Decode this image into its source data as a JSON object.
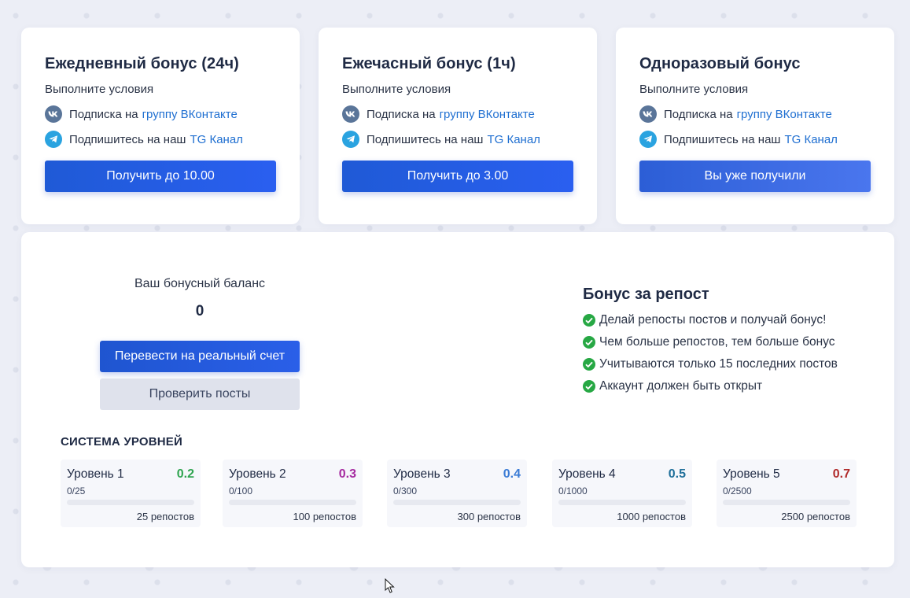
{
  "bonuses": [
    {
      "title": "Ежедневный бонус (24ч)",
      "subtitle": "Выполните условия",
      "vk_text": "Подписка на",
      "vk_link": "группу ВКонтакте",
      "tg_text": "Подпишитесь на наш",
      "tg_link": "TG Канал",
      "button": "Получить до 10.00"
    },
    {
      "title": "Ежечасный бонус (1ч)",
      "subtitle": "Выполните условия",
      "vk_text": "Подписка на",
      "vk_link": "группу ВКонтакте",
      "tg_text": "Подпишитесь на наш",
      "tg_link": "TG Канал",
      "button": "Получить до 3.00"
    },
    {
      "title": "Одноразовый бонус",
      "subtitle": "Выполните условия",
      "vk_text": "Подписка на",
      "vk_link": "группу ВКонтакте",
      "tg_text": "Подпишитесь на наш",
      "tg_link": "TG Канал",
      "button": "Вы уже получили"
    }
  ],
  "balance": {
    "label": "Ваш бонусный баланс",
    "value": "0",
    "transfer_button": "Перевести на реальный счет",
    "check_button": "Проверить посты"
  },
  "repost": {
    "title": "Бонус за репост",
    "items": [
      "Делай репосты постов и получай бонус!",
      "Чем больше репостов, тем больше бонус",
      "Учитываются только 15 последних постов",
      "Аккаунт должен быть открыт"
    ]
  },
  "levels": {
    "title": "СИСТЕМА УРОВНЕЙ",
    "items": [
      {
        "name": "Уровень 1",
        "rate": "0.2",
        "progress": "0/25",
        "progress_fraction": 0,
        "requirement": "25 репостов",
        "color": "#2ea44f"
      },
      {
        "name": "Уровень 2",
        "rate": "0.3",
        "progress": "0/100",
        "progress_fraction": 0,
        "requirement": "100 репостов",
        "color": "#a52aa0"
      },
      {
        "name": "Уровень 3",
        "rate": "0.4",
        "progress": "0/300",
        "progress_fraction": 0,
        "requirement": "300 репостов",
        "color": "#3a7bd5"
      },
      {
        "name": "Уровень 4",
        "rate": "0.5",
        "progress": "0/1000",
        "progress_fraction": 0,
        "requirement": "1000 репостов",
        "color": "#1f6f9a"
      },
      {
        "name": "Уровень 5",
        "rate": "0.7",
        "progress": "0/2500",
        "progress_fraction": 0,
        "requirement": "2500 репостов",
        "color": "#b02a2a"
      }
    ]
  },
  "colors": {
    "accent": "#2a5fe8",
    "link": "#1f6fd1",
    "check_green": "#27a844",
    "vk": "#5a7599",
    "telegram": "#2aa3e0"
  },
  "icons": {
    "vk": "vk-icon",
    "telegram": "telegram-icon",
    "check": "check-circle-icon",
    "cursor": "mouse-cursor-icon"
  }
}
